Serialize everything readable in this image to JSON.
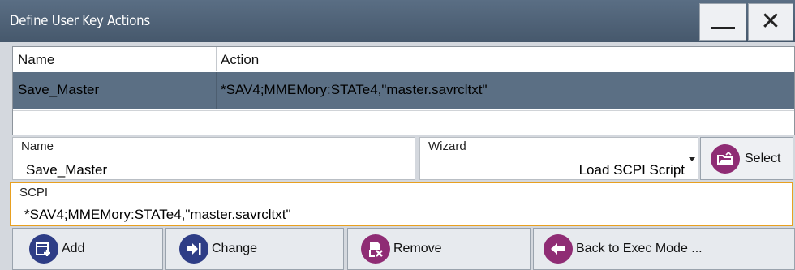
{
  "window": {
    "title": "Define User Key Actions",
    "minimize_icon": "minimize-icon",
    "close_icon": "close-icon"
  },
  "table": {
    "headers": [
      "Name",
      "Action"
    ],
    "rows": [
      {
        "name": "Save_Master",
        "action": "*SAV4;MMEMory:STATe4,\"master.savrcltxt\""
      }
    ]
  },
  "name_field": {
    "label": "Name",
    "value": "Save_Master"
  },
  "wizard_field": {
    "label": "Wizard",
    "value": "Load SCPI Script"
  },
  "select_button": {
    "label": "Select",
    "icon": "folder-open-icon"
  },
  "scpi_field": {
    "label": "SCPI",
    "value": "*SAV4;MMEMory:STATe4,\"master.savrcltxt\""
  },
  "buttons": {
    "add": {
      "label": "Add",
      "icon": "add-icon"
    },
    "change": {
      "label": "Change",
      "icon": "change-icon"
    },
    "remove": {
      "label": "Remove",
      "icon": "remove-icon"
    },
    "back": {
      "label": "Back to Exec Mode ...",
      "icon": "back-icon"
    }
  },
  "colors": {
    "titlebar": "#4f6378",
    "selected_row": "#5b6f84",
    "focus_border": "#e8a020",
    "purple_icon": "#8f2c74",
    "blue_icon": "#2e3d86"
  }
}
